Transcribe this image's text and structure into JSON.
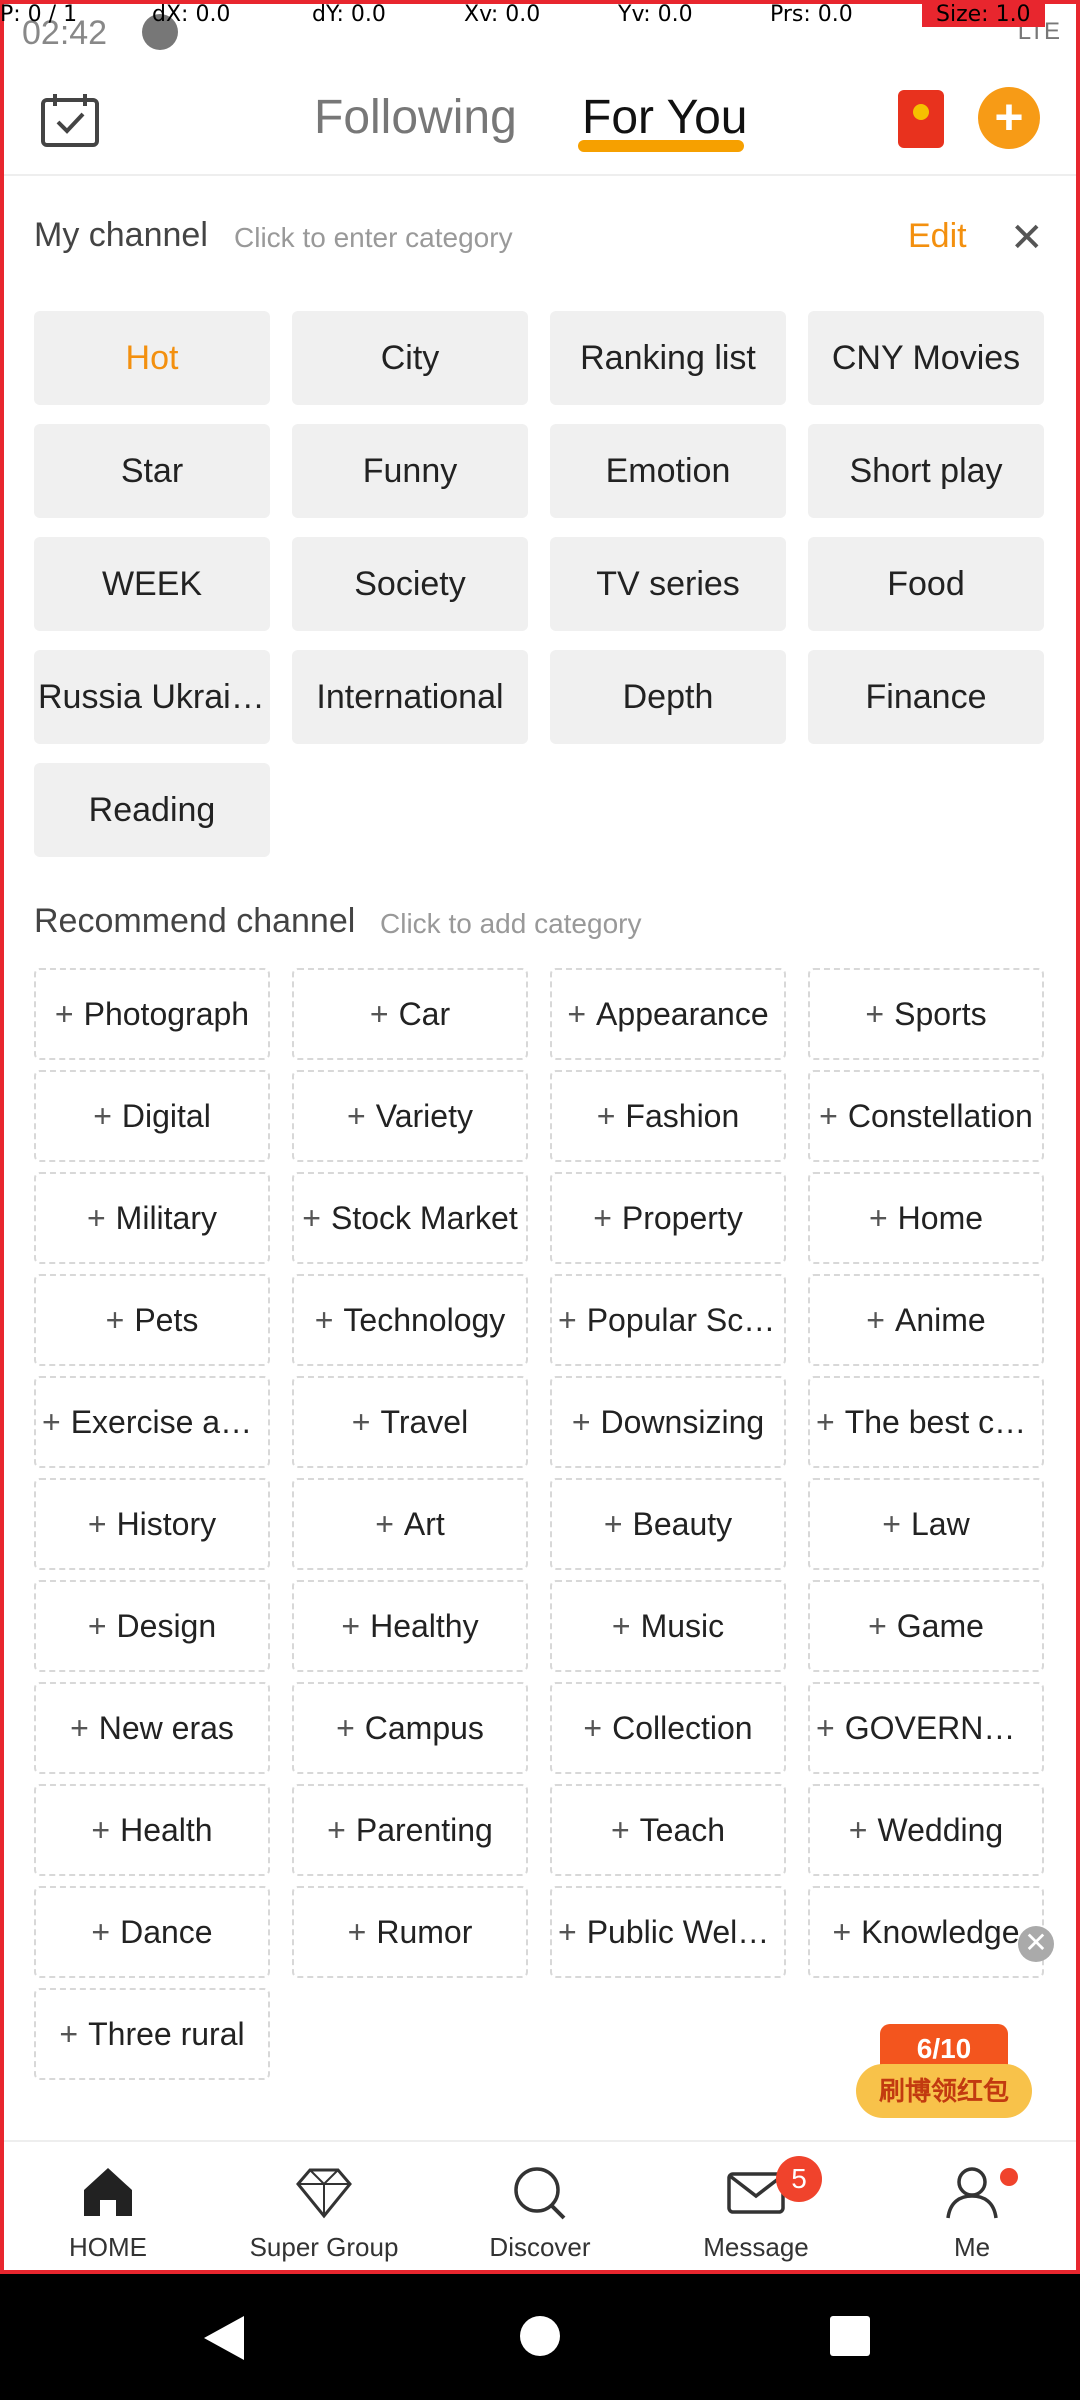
{
  "debug": {
    "pointer": "P: 0 / 1",
    "dx": "dX: 0.0",
    "dy": "dY: 0.0",
    "xv": "Xv: 0.0",
    "yv": "Yv: 0.0",
    "prs": "Prs: 0.0",
    "size": "Size: 1.0"
  },
  "status": {
    "time": "02:42",
    "network": "LTE"
  },
  "header": {
    "tabs": [
      {
        "label": "Following",
        "active": false
      },
      {
        "label": "For You",
        "active": true
      }
    ],
    "accent": "#f6a000",
    "icons": [
      "calendar-check-icon",
      "red-packet-icon",
      "plus-icon"
    ]
  },
  "my_channel": {
    "title": "My channel",
    "hint": "Click to enter category",
    "edit_label": "Edit",
    "close_label": "✕",
    "items": [
      "Hot",
      "City",
      "Ranking list",
      "CNY Movies",
      "Star",
      "Funny",
      "Emotion",
      "Short play",
      "WEEK",
      "Society",
      "TV series",
      "Food",
      "Russia Ukrain…",
      "International",
      "Depth",
      "Finance",
      "Reading"
    ],
    "active_index": 0
  },
  "recommend_channel": {
    "title": "Recommend channel",
    "hint": "Click to add category",
    "items": [
      "Photograph",
      "Car",
      "Appearance",
      "Sports",
      "Digital",
      "Variety",
      "Fashion",
      "Constellation",
      "Military",
      "Stock Market",
      "Property",
      "Home",
      "Pets",
      "Technology",
      "Popular Sci…",
      "Anime",
      "Exercise an…",
      "Travel",
      "Downsizing",
      "The best ch…",
      "History",
      "Art",
      "Beauty",
      "Law",
      "Design",
      "Healthy",
      "Music",
      "Game",
      "New eras",
      "Campus",
      "Collection",
      "GOVERNME…",
      "Health",
      "Parenting",
      "Teach",
      "Wedding",
      "Dance",
      "Rumor",
      "Public Welf…",
      "Knowledge",
      "Three rural"
    ]
  },
  "promo": {
    "progress": "6/10",
    "label": "刷博领红包"
  },
  "bottom_nav": [
    {
      "label": "HOME",
      "icon": "home-icon"
    },
    {
      "label": "Super Group",
      "icon": "diamond-icon"
    },
    {
      "label": "Discover",
      "icon": "search-icon"
    },
    {
      "label": "Message",
      "icon": "mail-icon",
      "badge": "5"
    },
    {
      "label": "Me",
      "icon": "person-icon",
      "dot": true
    }
  ]
}
